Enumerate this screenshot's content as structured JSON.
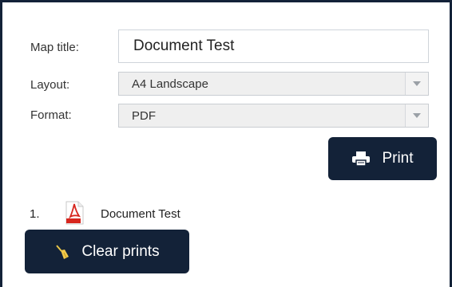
{
  "form": {
    "map_title_label": "Map title:",
    "map_title_value": "Document Test",
    "layout_label": "Layout:",
    "layout_value": "A4 Landscape",
    "format_label": "Format:",
    "format_value": "PDF"
  },
  "actions": {
    "print_label": "Print",
    "clear_label": "Clear prints"
  },
  "results": [
    {
      "index": "1.",
      "name": "Document Test",
      "icon": "pdf-icon"
    }
  ],
  "colors": {
    "button_bg": "#132238",
    "frame_border": "#132238",
    "pdf_red": "#d7261e"
  }
}
